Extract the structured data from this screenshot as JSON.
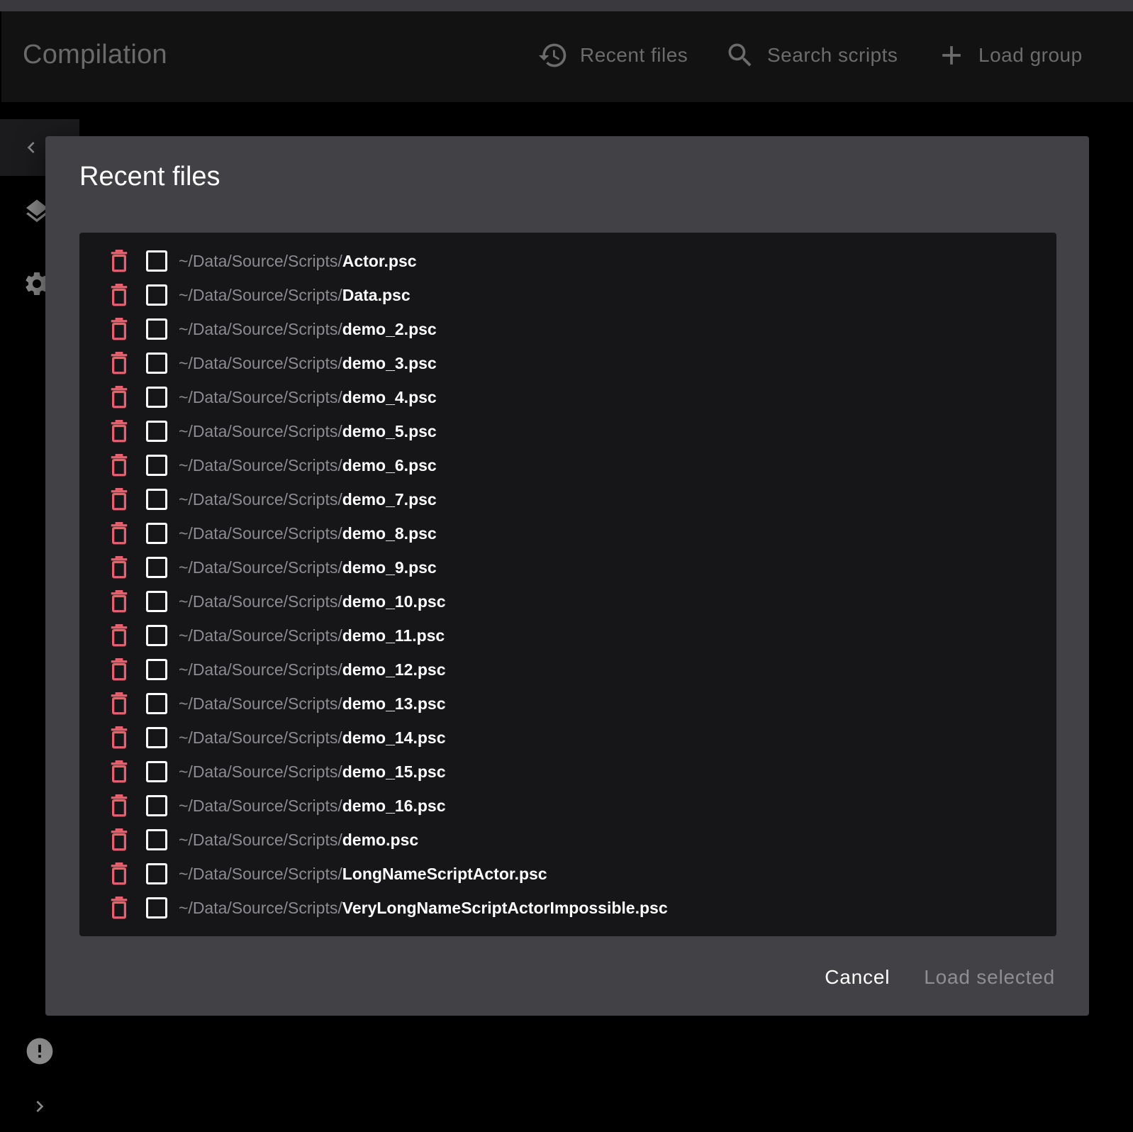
{
  "app": {
    "title": "Compilation"
  },
  "toolbar": {
    "recent_files": {
      "label": "Recent files",
      "icon": "history-icon"
    },
    "search_scripts": {
      "label": "Search scripts",
      "icon": "search-icon"
    },
    "load_group": {
      "label": "Load group",
      "icon": "plus-icon"
    }
  },
  "sidebar": {
    "icons": [
      "collapse-left-icon",
      "layers-icon",
      "gear-icon",
      "alert-icon",
      "expand-right-icon"
    ]
  },
  "dialog": {
    "title": "Recent files",
    "cancel_label": "Cancel",
    "load_selected_label": "Load selected",
    "files": [
      {
        "dir": "~/Data/Source/Scripts/",
        "name": "Actor.psc",
        "checked": false
      },
      {
        "dir": "~/Data/Source/Scripts/",
        "name": "Data.psc",
        "checked": false
      },
      {
        "dir": "~/Data/Source/Scripts/",
        "name": "demo_2.psc",
        "checked": false
      },
      {
        "dir": "~/Data/Source/Scripts/",
        "name": "demo_3.psc",
        "checked": false
      },
      {
        "dir": "~/Data/Source/Scripts/",
        "name": "demo_4.psc",
        "checked": false
      },
      {
        "dir": "~/Data/Source/Scripts/",
        "name": "demo_5.psc",
        "checked": false
      },
      {
        "dir": "~/Data/Source/Scripts/",
        "name": "demo_6.psc",
        "checked": false
      },
      {
        "dir": "~/Data/Source/Scripts/",
        "name": "demo_7.psc",
        "checked": false
      },
      {
        "dir": "~/Data/Source/Scripts/",
        "name": "demo_8.psc",
        "checked": false
      },
      {
        "dir": "~/Data/Source/Scripts/",
        "name": "demo_9.psc",
        "checked": false
      },
      {
        "dir": "~/Data/Source/Scripts/",
        "name": "demo_10.psc",
        "checked": false
      },
      {
        "dir": "~/Data/Source/Scripts/",
        "name": "demo_11.psc",
        "checked": false
      },
      {
        "dir": "~/Data/Source/Scripts/",
        "name": "demo_12.psc",
        "checked": false
      },
      {
        "dir": "~/Data/Source/Scripts/",
        "name": "demo_13.psc",
        "checked": false
      },
      {
        "dir": "~/Data/Source/Scripts/",
        "name": "demo_14.psc",
        "checked": false
      },
      {
        "dir": "~/Data/Source/Scripts/",
        "name": "demo_15.psc",
        "checked": false
      },
      {
        "dir": "~/Data/Source/Scripts/",
        "name": "demo_16.psc",
        "checked": false
      },
      {
        "dir": "~/Data/Source/Scripts/",
        "name": "demo.psc",
        "checked": false
      },
      {
        "dir": "~/Data/Source/Scripts/",
        "name": "LongNameScriptActor.psc",
        "checked": false
      },
      {
        "dir": "~/Data/Source/Scripts/",
        "name": "VeryLongNameScriptActorImpossible.psc",
        "checked": false
      }
    ]
  },
  "colors": {
    "delete_icon": "#e8606e",
    "dialog_bg": "#424145",
    "list_bg": "#161619",
    "app_bar_bg": "#121212"
  }
}
